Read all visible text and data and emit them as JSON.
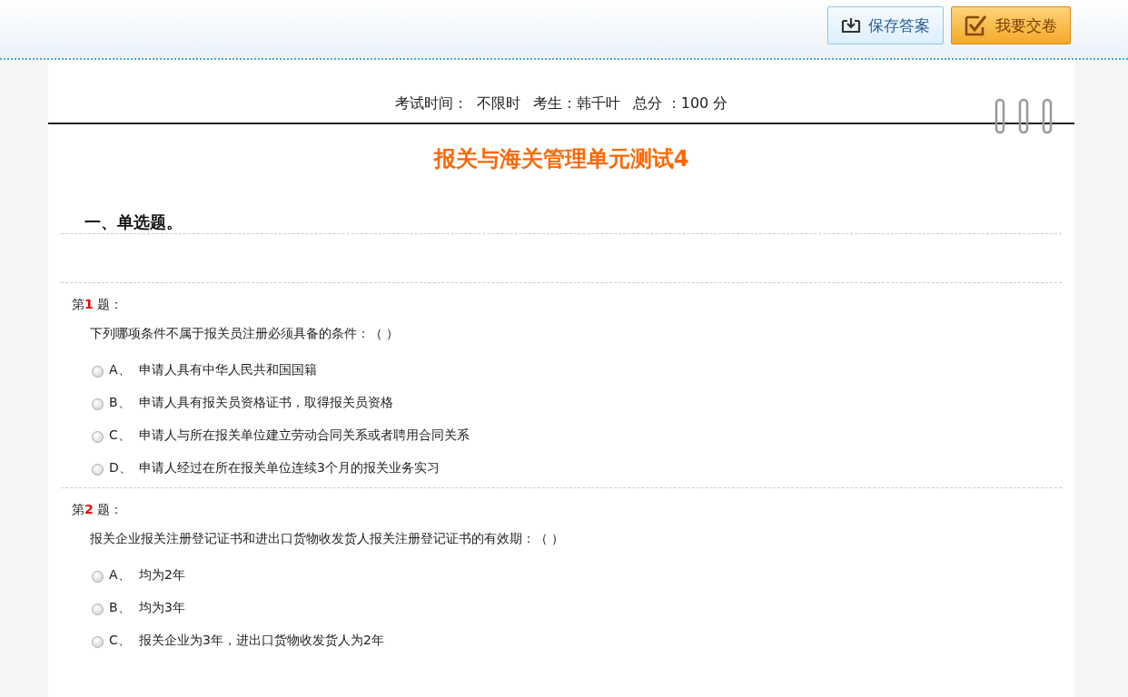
{
  "toolbar": {
    "buttons": [
      {
        "kind": "save",
        "label": "保存答案"
      },
      {
        "kind": "submit",
        "label": "我要交卷"
      }
    ]
  },
  "exam_info": [
    "考试时间：",
    "不限时",
    "考生：韩千叶",
    "总分 ：100 分"
  ],
  "title": "报关与海关管理单元测试4",
  "section": "一、单选题。",
  "questions": [
    {
      "prefix": "第",
      "number": "1",
      "suffix": "题：",
      "text": "下列哪项条件不属于报关员注册必须具备的条件：（ ）",
      "options": [
        {
          "letter": "A、",
          "text": "申请人具有中华人民共和国国籍",
          "selected": false
        },
        {
          "letter": "B、",
          "text": "申请人具有报关员资格证书，取得报关员资格",
          "selected": false
        },
        {
          "letter": "C、",
          "text": "申请人与所在报关单位建立劳动合同关系或者聘用合同关系",
          "selected": false
        },
        {
          "letter": "D、",
          "text": "申请人经过在所在报关单位连续3个月的报关业务实习",
          "selected": false
        }
      ]
    },
    {
      "prefix": "第",
      "number": "2",
      "suffix": "题：",
      "text": "报关企业报关注册登记证书和进出口货物收发货人报关注册登记证书的有效期：（ ）",
      "options": [
        {
          "letter": "A、",
          "text": "均为2年",
          "selected": false
        },
        {
          "letter": "B、",
          "text": "均为3年",
          "selected": false
        },
        {
          "letter": "C、",
          "text": "报关企业为3年，进出口货物收发货人为2年",
          "selected": false
        }
      ]
    }
  ]
}
